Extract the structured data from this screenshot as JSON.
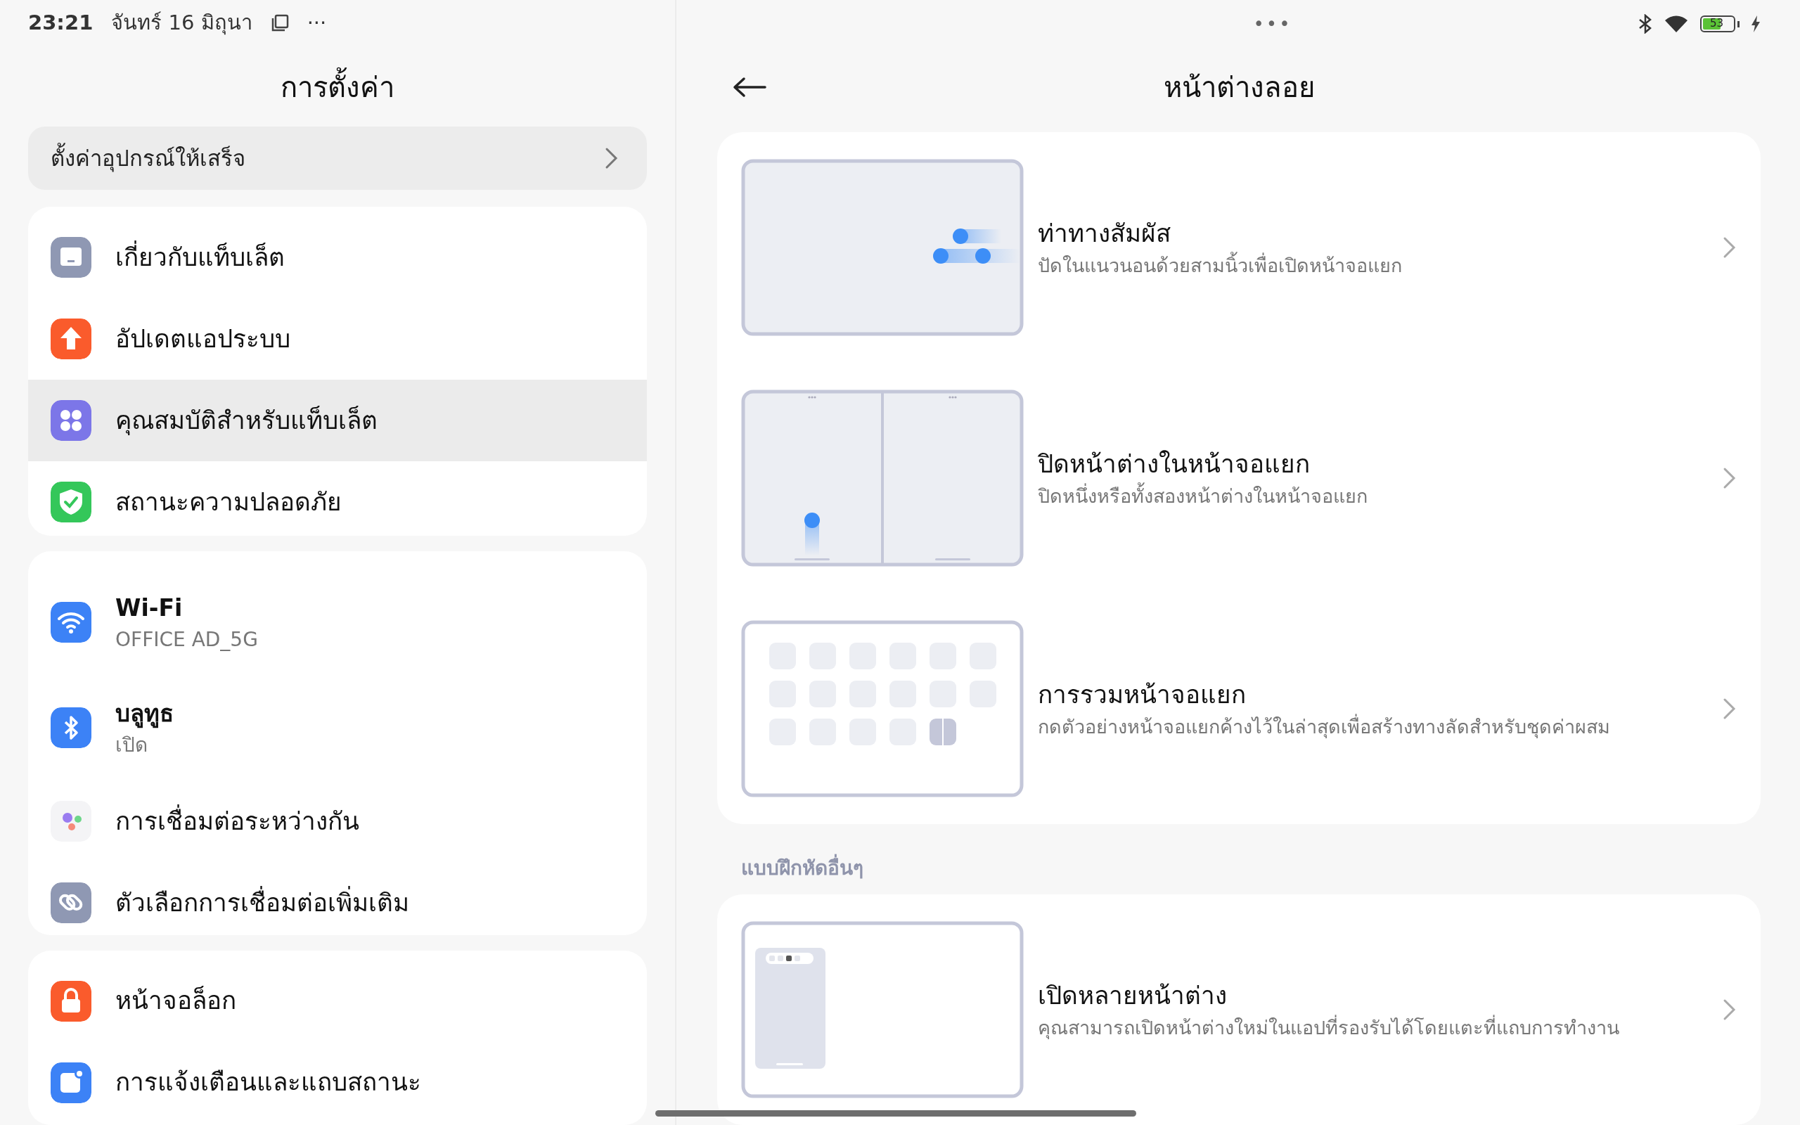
{
  "status_bar": {
    "time": "23:21",
    "date": "จันทร์ 16 มิถุนา",
    "more": "···",
    "battery": "53",
    "center_dots": "•••"
  },
  "settings": {
    "title": "การตั้งค่า",
    "setup_banner": "ตั้งค่าอุปกรณ์ให้เสร็จ",
    "groups": [
      {
        "items": [
          {
            "label": "เกี่ยวกับแท็บเล็ต",
            "selected": false
          },
          {
            "label": "อัปเดตแอประบบ",
            "selected": false
          },
          {
            "label": "คุณสมบัติสำหรับแท็บเล็ต",
            "selected": true
          },
          {
            "label": "สถานะความปลอดภัย",
            "selected": false
          }
        ]
      },
      {
        "items": [
          {
            "label": "Wi-Fi",
            "value": "OFFICE AD_5G",
            "selected": false
          },
          {
            "label": "บลูทูธ",
            "value": "เปิด",
            "selected": false
          },
          {
            "label": "การเชื่อมต่อระหว่างกัน",
            "selected": false
          },
          {
            "label": "ตัวเลือกการเชื่อมต่อเพิ่มเติม",
            "selected": false
          }
        ]
      },
      {
        "items": [
          {
            "label": "หน้าจอล็อก",
            "selected": false
          },
          {
            "label": "การแจ้งเตือนและแถบสถานะ",
            "selected": false
          }
        ]
      }
    ]
  },
  "detail": {
    "title": "หน้าต่างลอย",
    "sections": [
      {
        "items": [
          {
            "title": "ท่าทางสัมผัส",
            "subtitle": "ปัดในแนวนอนด้วยสามนิ้วเพื่อเปิดหน้าจอแยก"
          },
          {
            "title": "ปิดหน้าต่างในหน้าจอแยก",
            "subtitle": "ปิดหนึ่งหรือทั้งสองหน้าต่างในหน้าจอแยก"
          },
          {
            "title": "การรวมหน้าจอแยก",
            "subtitle": "กดตัวอย่างหน้าจอแยกค้างไว้ในล่าสุดเพื่อสร้างทางลัดสำหรับชุดค่าผสม"
          }
        ]
      },
      {
        "header": "แบบฝึกหัดอื่นๆ",
        "items": [
          {
            "title": "เปิดหลายหน้าต่าง",
            "subtitle": "คุณสามารถเปิดหน้าต่างใหม่ในแอปที่รองรับได้โดยแตะที่แถบการทำงาน"
          }
        ]
      }
    ]
  }
}
